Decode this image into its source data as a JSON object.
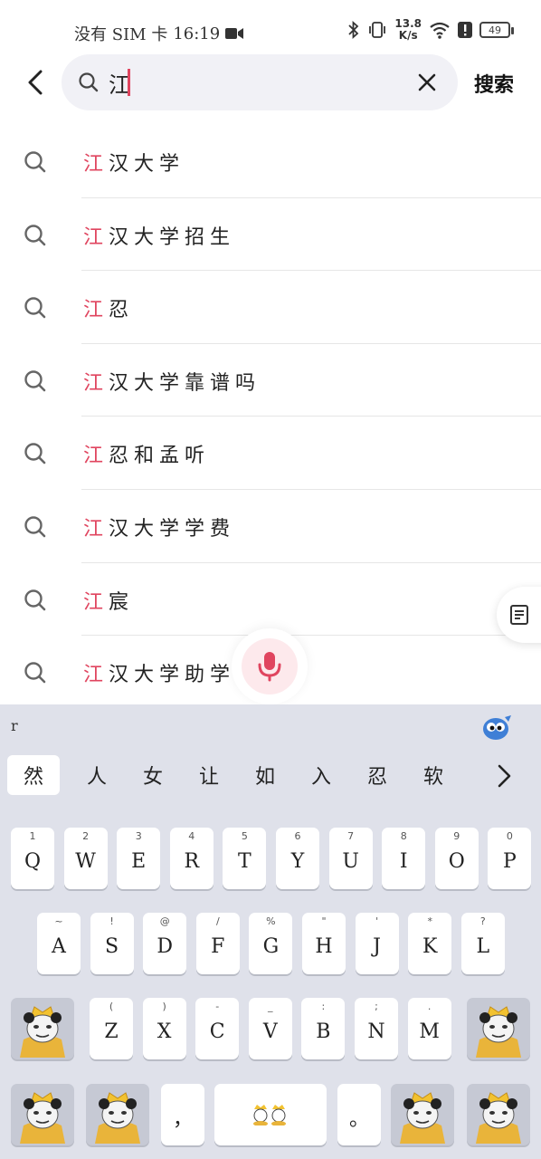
{
  "status_bar": {
    "carrier": "没有 SIM 卡",
    "time": "16:19",
    "net_speed_value": "13.8",
    "net_speed_unit": "K/s",
    "battery": "49"
  },
  "search": {
    "query": "江",
    "search_button_label": "搜索"
  },
  "suggestions": [
    {
      "highlight": "江",
      "rest": "汉大学"
    },
    {
      "highlight": "江",
      "rest": "汉大学招生"
    },
    {
      "highlight": "江",
      "rest": "忍"
    },
    {
      "highlight": "江",
      "rest": "汉大学靠谱吗"
    },
    {
      "highlight": "江",
      "rest": "忍和孟听"
    },
    {
      "highlight": "江",
      "rest": "汉大学学费"
    },
    {
      "highlight": "江",
      "rest": "宸"
    },
    {
      "highlight": "江",
      "rest": "汉大学助学班"
    }
  ],
  "keyboard": {
    "composing": "r",
    "candidates": [
      "然",
      "人",
      "女",
      "让",
      "如",
      "入",
      "忍",
      "软"
    ],
    "row1": [
      {
        "main": "Q",
        "sub": "1"
      },
      {
        "main": "W",
        "sub": "2"
      },
      {
        "main": "E",
        "sub": "3"
      },
      {
        "main": "R",
        "sub": "4"
      },
      {
        "main": "T",
        "sub": "5"
      },
      {
        "main": "Y",
        "sub": "6"
      },
      {
        "main": "U",
        "sub": "7"
      },
      {
        "main": "I",
        "sub": "8"
      },
      {
        "main": "O",
        "sub": "9"
      },
      {
        "main": "P",
        "sub": "0"
      }
    ],
    "row2": [
      {
        "main": "A",
        "sub": "~"
      },
      {
        "main": "S",
        "sub": "!"
      },
      {
        "main": "D",
        "sub": "@"
      },
      {
        "main": "F",
        "sub": "/"
      },
      {
        "main": "G",
        "sub": "%"
      },
      {
        "main": "H",
        "sub": "\""
      },
      {
        "main": "J",
        "sub": "'"
      },
      {
        "main": "K",
        "sub": "*"
      },
      {
        "main": "L",
        "sub": "?"
      }
    ],
    "row3": [
      {
        "main": "Z",
        "sub": "("
      },
      {
        "main": "X",
        "sub": ")"
      },
      {
        "main": "C",
        "sub": "-"
      },
      {
        "main": "V",
        "sub": "_"
      },
      {
        "main": "B",
        "sub": ":"
      },
      {
        "main": "N",
        "sub": ";"
      },
      {
        "main": "M",
        "sub": "."
      }
    ],
    "comma_label": "，",
    "period_label": "。"
  },
  "colors": {
    "accent": "#e0455f",
    "search_bg": "#f1f1f6",
    "keyboard_bg": "#dfe1ea"
  },
  "icons": {
    "back": "chevron-left-icon",
    "search": "search-icon",
    "clear": "close-icon",
    "mic": "microphone-icon",
    "doc": "document-icon",
    "more": "chevron-right-icon"
  }
}
